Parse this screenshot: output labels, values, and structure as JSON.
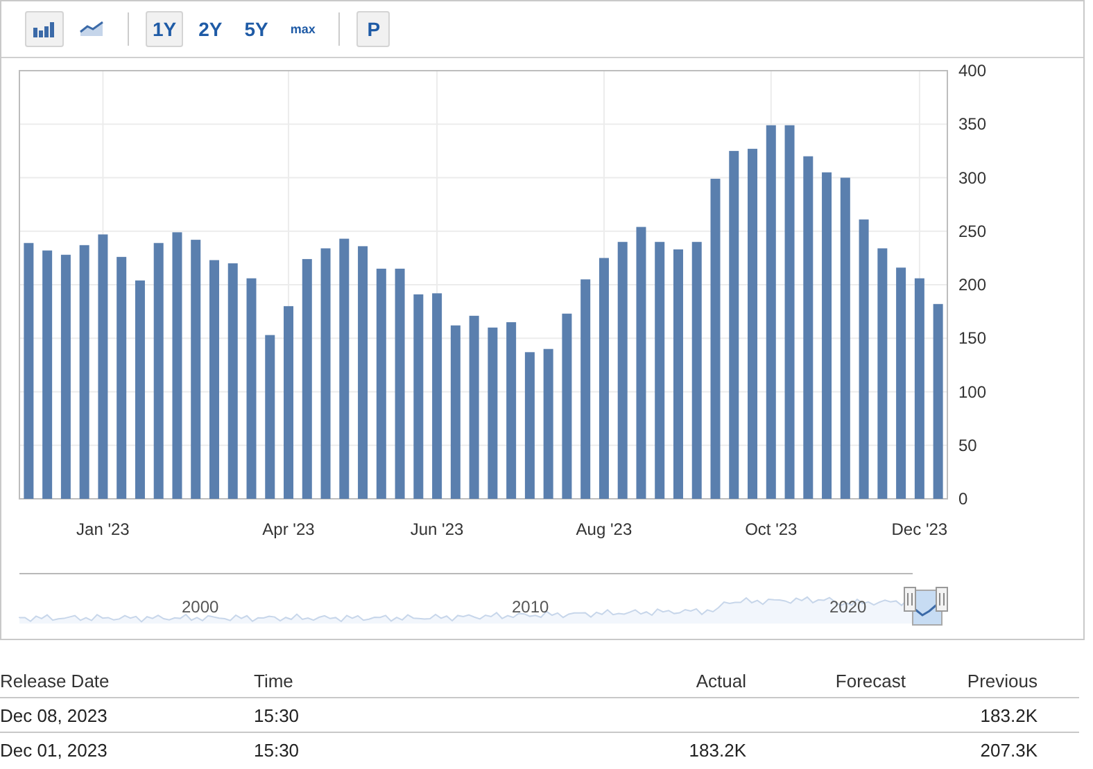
{
  "toolbar": {
    "chart_types": [
      {
        "kind": "bar",
        "selected": true
      },
      {
        "kind": "line",
        "selected": false
      }
    ],
    "ranges": [
      {
        "label": "1Y",
        "selected": true
      },
      {
        "label": "2Y",
        "selected": false
      },
      {
        "label": "5Y",
        "selected": false
      },
      {
        "label": "max",
        "selected": false
      }
    ],
    "p_button": {
      "label": "P",
      "selected": true
    }
  },
  "chart": {
    "chart_data": {
      "type": "bar",
      "orientation": "vertical",
      "grid": true,
      "categories": [
        null,
        null,
        null,
        null,
        "Jan '23",
        null,
        null,
        null,
        null,
        null,
        null,
        null,
        null,
        null,
        "Apr '23",
        null,
        null,
        null,
        null,
        null,
        null,
        null,
        "Jun '23",
        null,
        null,
        null,
        null,
        null,
        null,
        null,
        null,
        "Aug '23",
        null,
        null,
        null,
        null,
        null,
        null,
        null,
        null,
        "Oct '23",
        null,
        null,
        null,
        null,
        null,
        null,
        null,
        "Dec '23",
        null
      ],
      "series": [
        {
          "color": "#5a7fae",
          "values": [
            239,
            232,
            228,
            237,
            247,
            226,
            204,
            239,
            249,
            242,
            223,
            220,
            206,
            153,
            180,
            224,
            234,
            243,
            236,
            215,
            215,
            191,
            192,
            162,
            171,
            160,
            165,
            137,
            140,
            173,
            205,
            225,
            240,
            254,
            240,
            233,
            240,
            299,
            325,
            327,
            349,
            349,
            320,
            305,
            300,
            261,
            234,
            216,
            206,
            182
          ]
        }
      ],
      "ylim": [
        0,
        400
      ],
      "yticks": [
        0,
        50,
        100,
        150,
        200,
        250,
        300,
        350,
        400
      ]
    }
  },
  "navigator": {
    "labels": [
      "2000",
      "2010",
      "2020"
    ]
  },
  "table": {
    "columns": [
      "Release Date",
      "Time",
      "Actual",
      "Forecast",
      "Previous"
    ],
    "rows": [
      {
        "release_date": "Dec 08, 2023",
        "time": "15:30",
        "previous": "183.2K"
      },
      {
        "release_date": "Dec 01, 2023",
        "time": "15:30",
        "actual": "183.2K",
        "previous": "207.3K"
      }
    ]
  }
}
